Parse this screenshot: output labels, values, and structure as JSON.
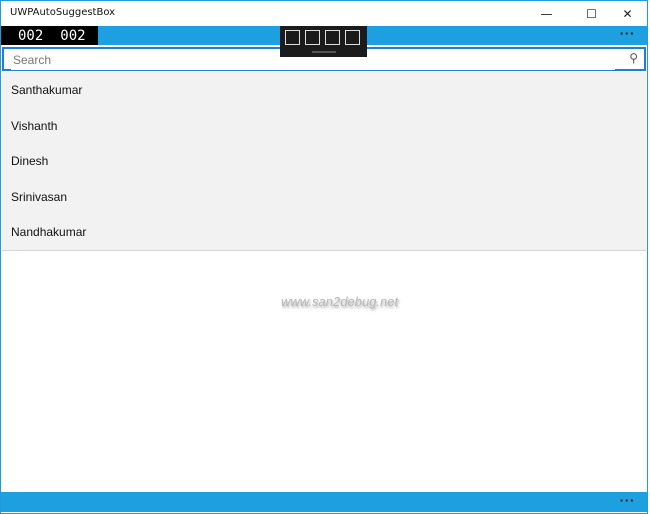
{
  "window": {
    "title": "UWPAutoSuggestBox",
    "minimize": "—",
    "maximize": "☐",
    "close": "✕"
  },
  "frame_counter": [
    "002",
    "002"
  ],
  "appbar": {
    "more": "···"
  },
  "search": {
    "placeholder": "Search",
    "value": "",
    "icon": "search-icon"
  },
  "suggestions": [
    "Santhakumar",
    "Vishanth",
    "Dinesh",
    "Srinivasan",
    "Nandhakumar"
  ],
  "watermark": "www.san2debug.net",
  "bottom_appbar": {
    "more": "···"
  },
  "colors": {
    "accent": "#1e9fe0",
    "focus_border": "#1e7fd4",
    "list_bg": "#f2f2f2"
  }
}
